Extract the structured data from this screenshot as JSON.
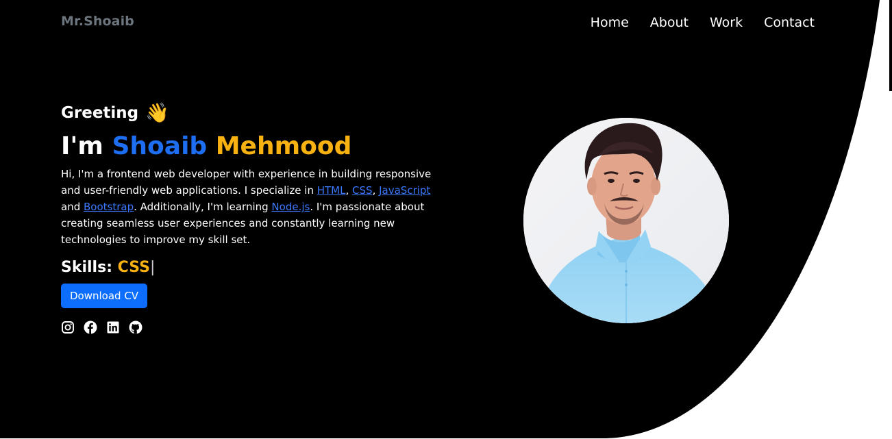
{
  "navbar": {
    "brand": "Mr.Shoaib",
    "links": [
      "Home",
      "About",
      "Work",
      "Contact"
    ]
  },
  "hero": {
    "greeting": "Greeting",
    "greeting_emoji": "👋",
    "headline_prefix": "I'm",
    "name_first": "Shoaib",
    "name_last": "Mehmood",
    "intro": {
      "p1": "Hi, I'm a frontend web developer with experience in building responsive and user-friendly web applications. I specialize in ",
      "link_html": "HTML",
      "sep1": ", ",
      "link_css": "CSS",
      "sep2": ", ",
      "link_js": "JavaScript",
      "sep3": " and ",
      "link_bootstrap": "Bootstrap",
      "p2": ". Additionally, I'm learning ",
      "link_node": "Node.js",
      "p3": ". I'm passionate about creating seamless user experiences and constantly learning new technologies to improve my skill set."
    },
    "skills_label": "Skills:",
    "skills_value": "CSS",
    "skills_cursor": "|",
    "cv_button": "Download CV",
    "social_icons": [
      "instagram-icon",
      "facebook-icon",
      "linkedin-icon",
      "github-icon"
    ]
  },
  "colors": {
    "background": "#000000",
    "accent_blue": "#1d6ef0",
    "accent_yellow": "#f7b111",
    "button_blue": "#0d6efd",
    "brand_gray": "#6c757d"
  }
}
